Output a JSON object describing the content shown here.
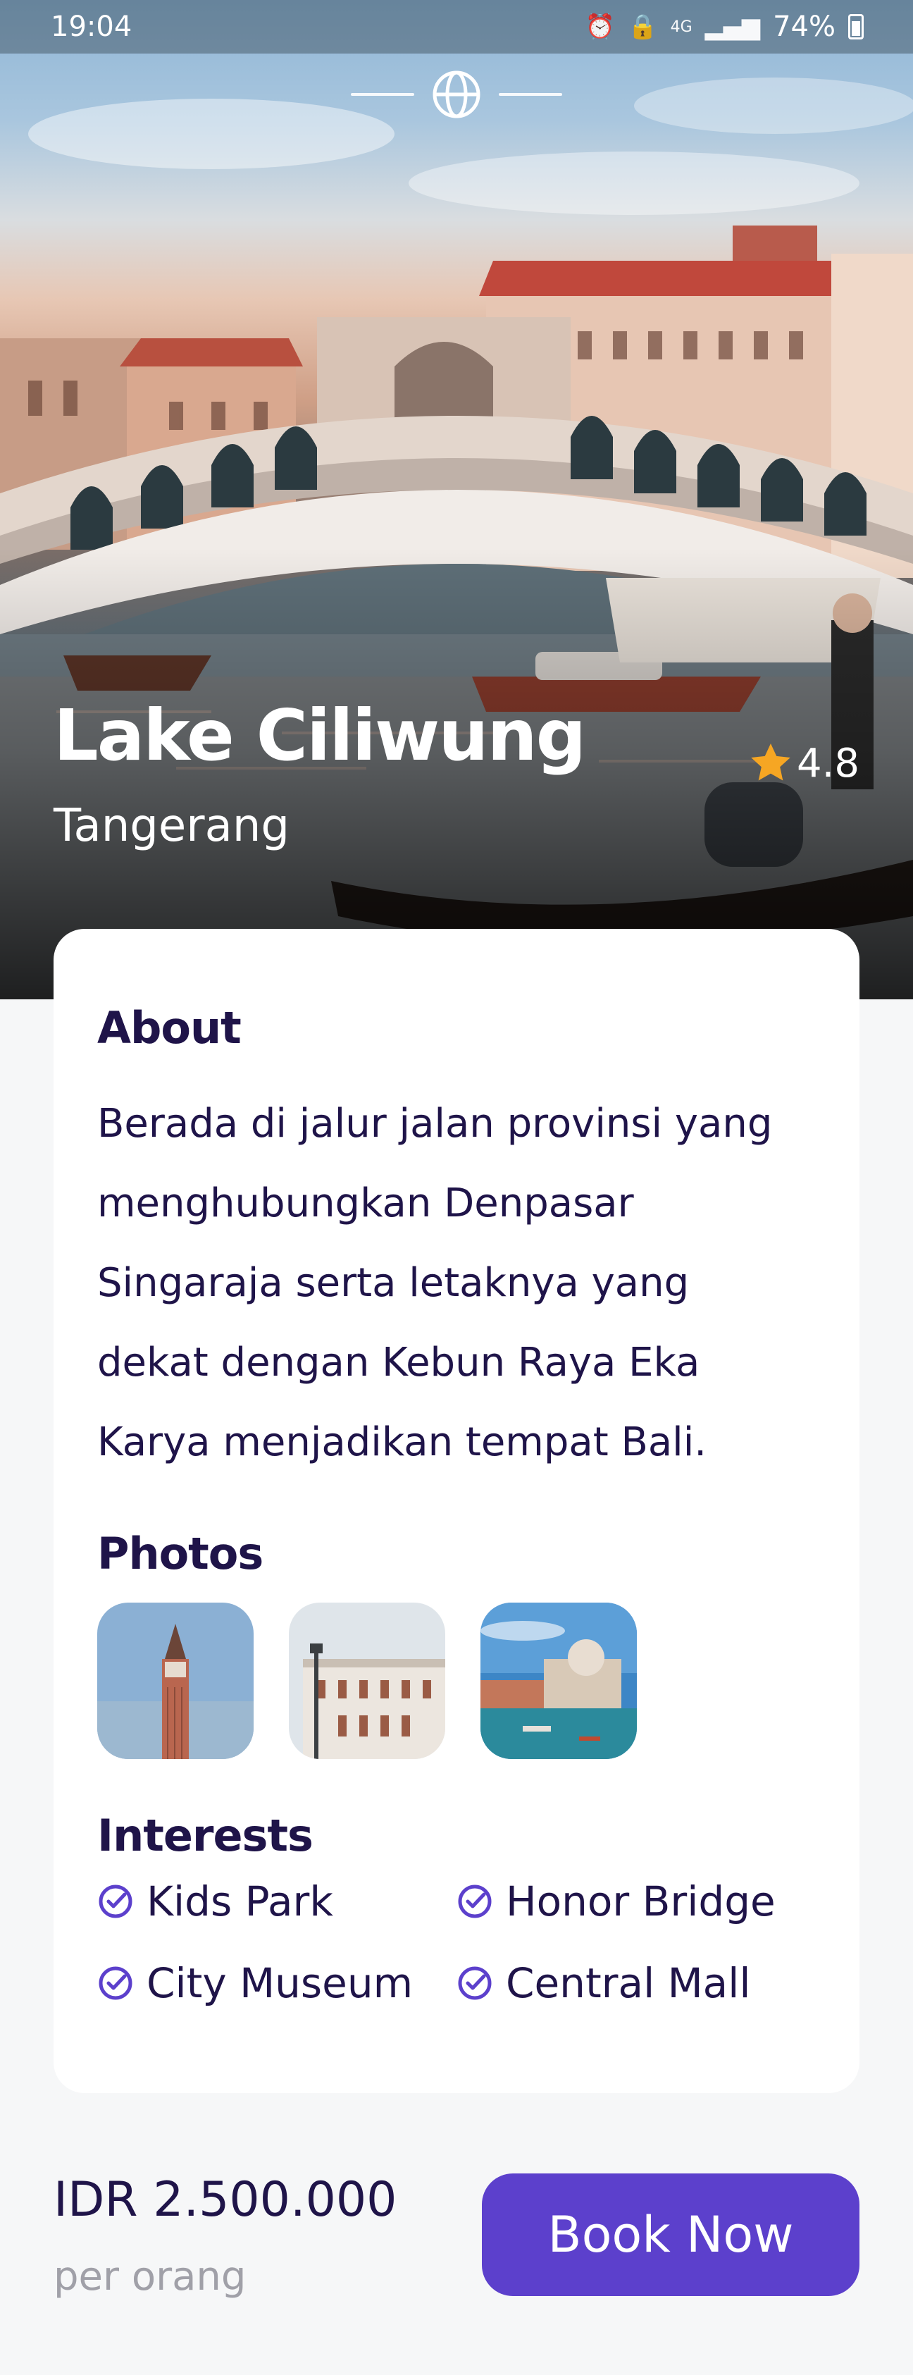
{
  "status_bar": {
    "time": "19:04",
    "icons": [
      "alarm-icon",
      "lock-icon",
      "4g-icon",
      "signal-icon"
    ],
    "battery": "74%"
  },
  "hero": {
    "logo_icon": "globe-icon",
    "title": "Lake Ciliwung",
    "subtitle": "Tangerang",
    "rating": "4.8",
    "rating_icon": "star-icon",
    "rating_color": "#F6A623"
  },
  "about": {
    "title": "About",
    "text_lines": [
      "Berada di jalur jalan provinsi yang",
      "menghubungkan Denpasar",
      "Singaraja serta letaknya yang",
      "dekat dengan Kebun Raya Eka",
      "Karya menjadikan tempat Bali."
    ]
  },
  "photos": {
    "title": "Photos"
  },
  "interests": {
    "title": "Interests",
    "items": [
      "Kids Park",
      "Honor Bridge",
      "City Museum",
      "Central Mall"
    ],
    "check_color": "#5C40CC"
  },
  "booking": {
    "price": "IDR 2.500.000",
    "unit": "per orang",
    "button_label": "Book Now",
    "accent": "#5C40CC"
  }
}
